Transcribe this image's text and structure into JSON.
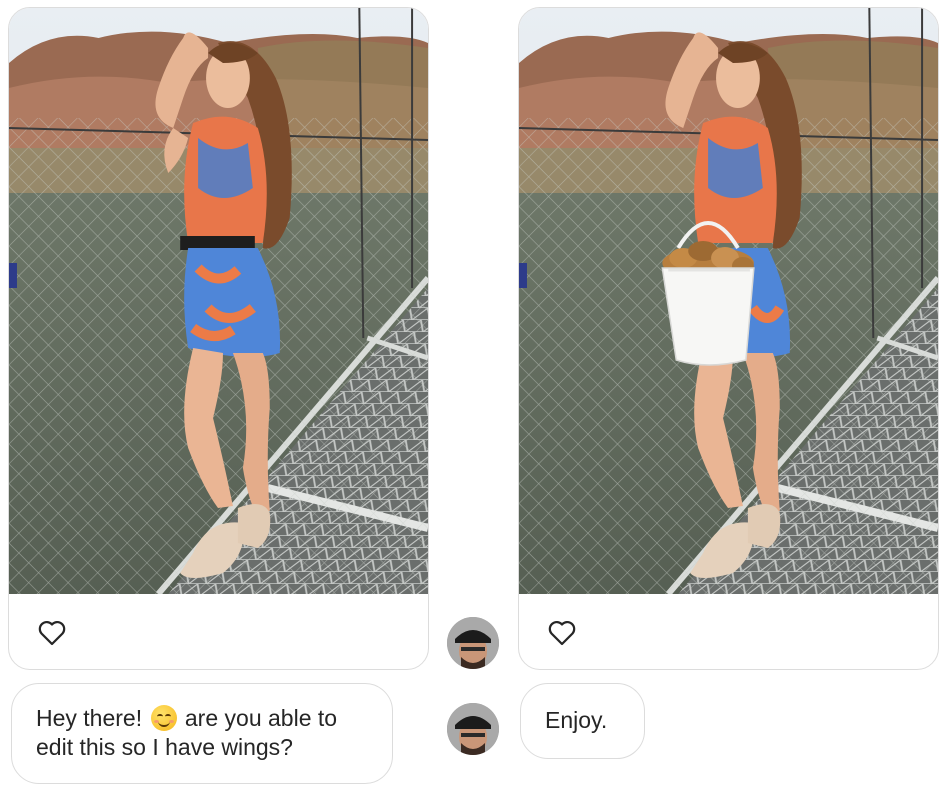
{
  "thread": {
    "messages": [
      {
        "sender": "them",
        "type": "photo",
        "photo_icon": "photo-woman-on-net-bridge",
        "reaction_icon": "heart-icon"
      },
      {
        "sender": "them",
        "type": "text",
        "text_before_emoji": "Hey there!",
        "emoji": "smiling-face-emoji",
        "text_after_emoji": "are you able to",
        "text_line2": "edit this so I have wings?"
      },
      {
        "sender": "me",
        "type": "photo",
        "photo_icon": "photo-woman-with-bucket-of-wings",
        "reaction_icon": "heart-icon"
      },
      {
        "sender": "me",
        "type": "text",
        "text": "Enjoy."
      }
    ]
  },
  "colors": {
    "bubble_border": "#dcdcdc",
    "text": "#262626",
    "background": "#ffffff"
  }
}
